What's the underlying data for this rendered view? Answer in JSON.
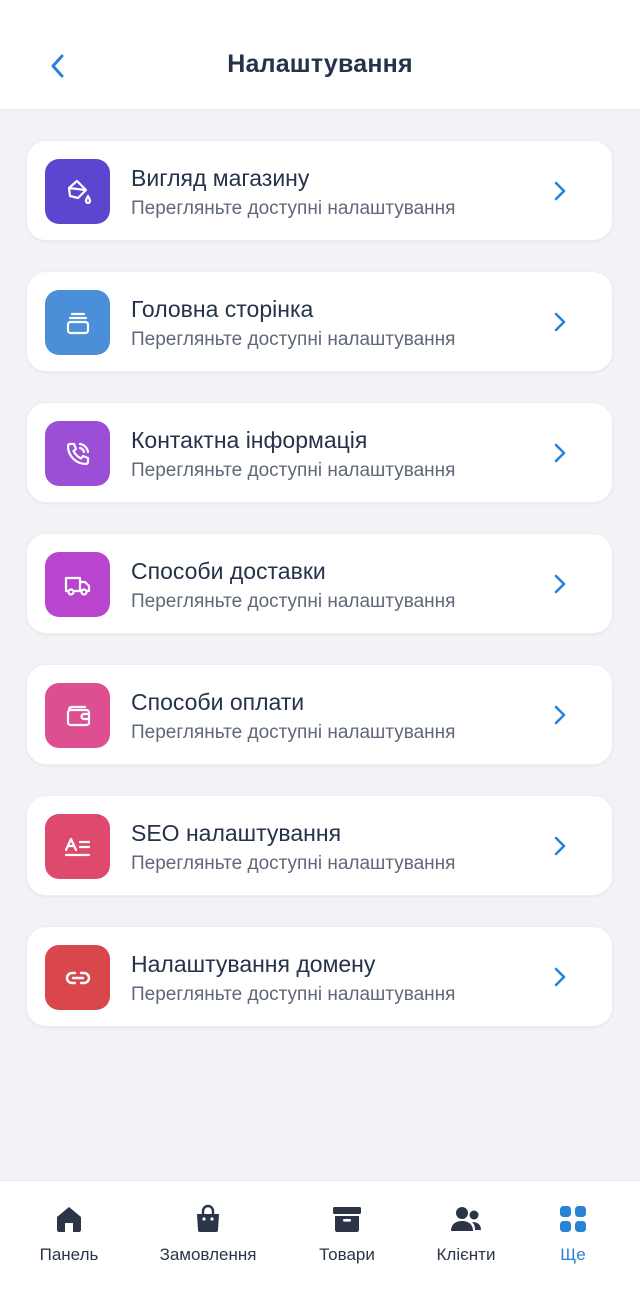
{
  "header": {
    "title": "Налаштування",
    "back_icon": "chevron-left-icon",
    "accent": "#2a82d7"
  },
  "items": [
    {
      "title": "Вигляд магазину",
      "subtitle": "Перегляньте доступні налаштування",
      "icon": "paint-bucket-icon",
      "color": "#5b46cf"
    },
    {
      "title": "Головна сторінка",
      "subtitle": "Перегляньте доступні налаштування",
      "icon": "stack-icon",
      "color": "#4a8fd8"
    },
    {
      "title": "Контактна інформація",
      "subtitle": "Перегляньте доступні налаштування",
      "icon": "phone-icon",
      "color": "#9b4fd6"
    },
    {
      "title": "Способи доставки",
      "subtitle": "Перегляньте доступні налаштування",
      "icon": "truck-icon",
      "color": "#b945cf"
    },
    {
      "title": "Способи оплати",
      "subtitle": "Перегляньте доступні налаштування",
      "icon": "wallet-icon",
      "color": "#de4f92"
    },
    {
      "title": "SEO налаштування",
      "subtitle": "Перегляньте доступні налаштування",
      "icon": "text-format-icon",
      "color": "#dd4a6e"
    },
    {
      "title": "Налаштування домену",
      "subtitle": "Перегляньте доступні налаштування",
      "icon": "link-icon",
      "color": "#d9474c"
    }
  ],
  "tabbar": {
    "tabs": [
      {
        "label": "Панель",
        "icon": "home-icon",
        "active": false
      },
      {
        "label": "Замовлення",
        "icon": "shopping-bag-icon",
        "active": false
      },
      {
        "label": "Товари",
        "icon": "archive-box-icon",
        "active": false
      },
      {
        "label": "Клієнти",
        "icon": "users-icon",
        "active": false
      },
      {
        "label": "Ще",
        "icon": "grid-icon",
        "active": true
      }
    ],
    "active_color": "#2a82d7",
    "inactive_color": "#2c3548"
  }
}
